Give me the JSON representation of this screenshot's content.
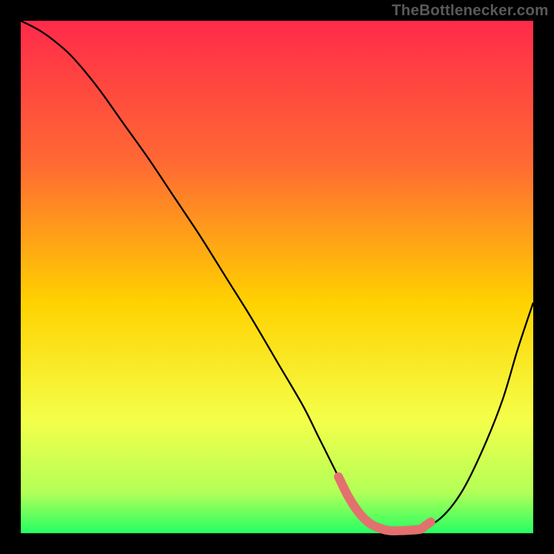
{
  "watermark": "TheBottlenecker.com",
  "chart_data": {
    "type": "line",
    "title": "",
    "xlabel": "",
    "ylabel": "",
    "xlim": [
      0,
      100
    ],
    "ylim": [
      0,
      100
    ],
    "grid": false,
    "legend": false,
    "background_gradient": {
      "top": "#ff2a4a",
      "middle": "#ffe300",
      "bottom": "#25ff63"
    },
    "series": [
      {
        "name": "bottleneck-curve",
        "color": "#000000",
        "x": [
          0,
          3,
          6,
          10,
          15,
          20,
          25,
          30,
          35,
          40,
          45,
          50,
          55,
          58,
          60,
          62,
          64,
          66,
          68,
          70,
          72,
          75,
          78,
          82,
          86,
          90,
          94,
          97,
          100
        ],
        "y": [
          100,
          98.5,
          96.5,
          93,
          87,
          80,
          73,
          65.5,
          58,
          50,
          42,
          33.5,
          25,
          19,
          15,
          11,
          7,
          4,
          2,
          1,
          0.5,
          0.5,
          0.8,
          3,
          8,
          16,
          26,
          36,
          45
        ]
      },
      {
        "name": "optimal-range-marker",
        "color": "#e2706f",
        "type": "scatter",
        "x": [
          62,
          64,
          66,
          68,
          70,
          72,
          74,
          76,
          78,
          79,
          80
        ],
        "y": [
          11,
          7,
          4,
          2,
          1,
          0.5,
          0.5,
          0.6,
          0.8,
          1.5,
          2.2
        ]
      }
    ]
  }
}
